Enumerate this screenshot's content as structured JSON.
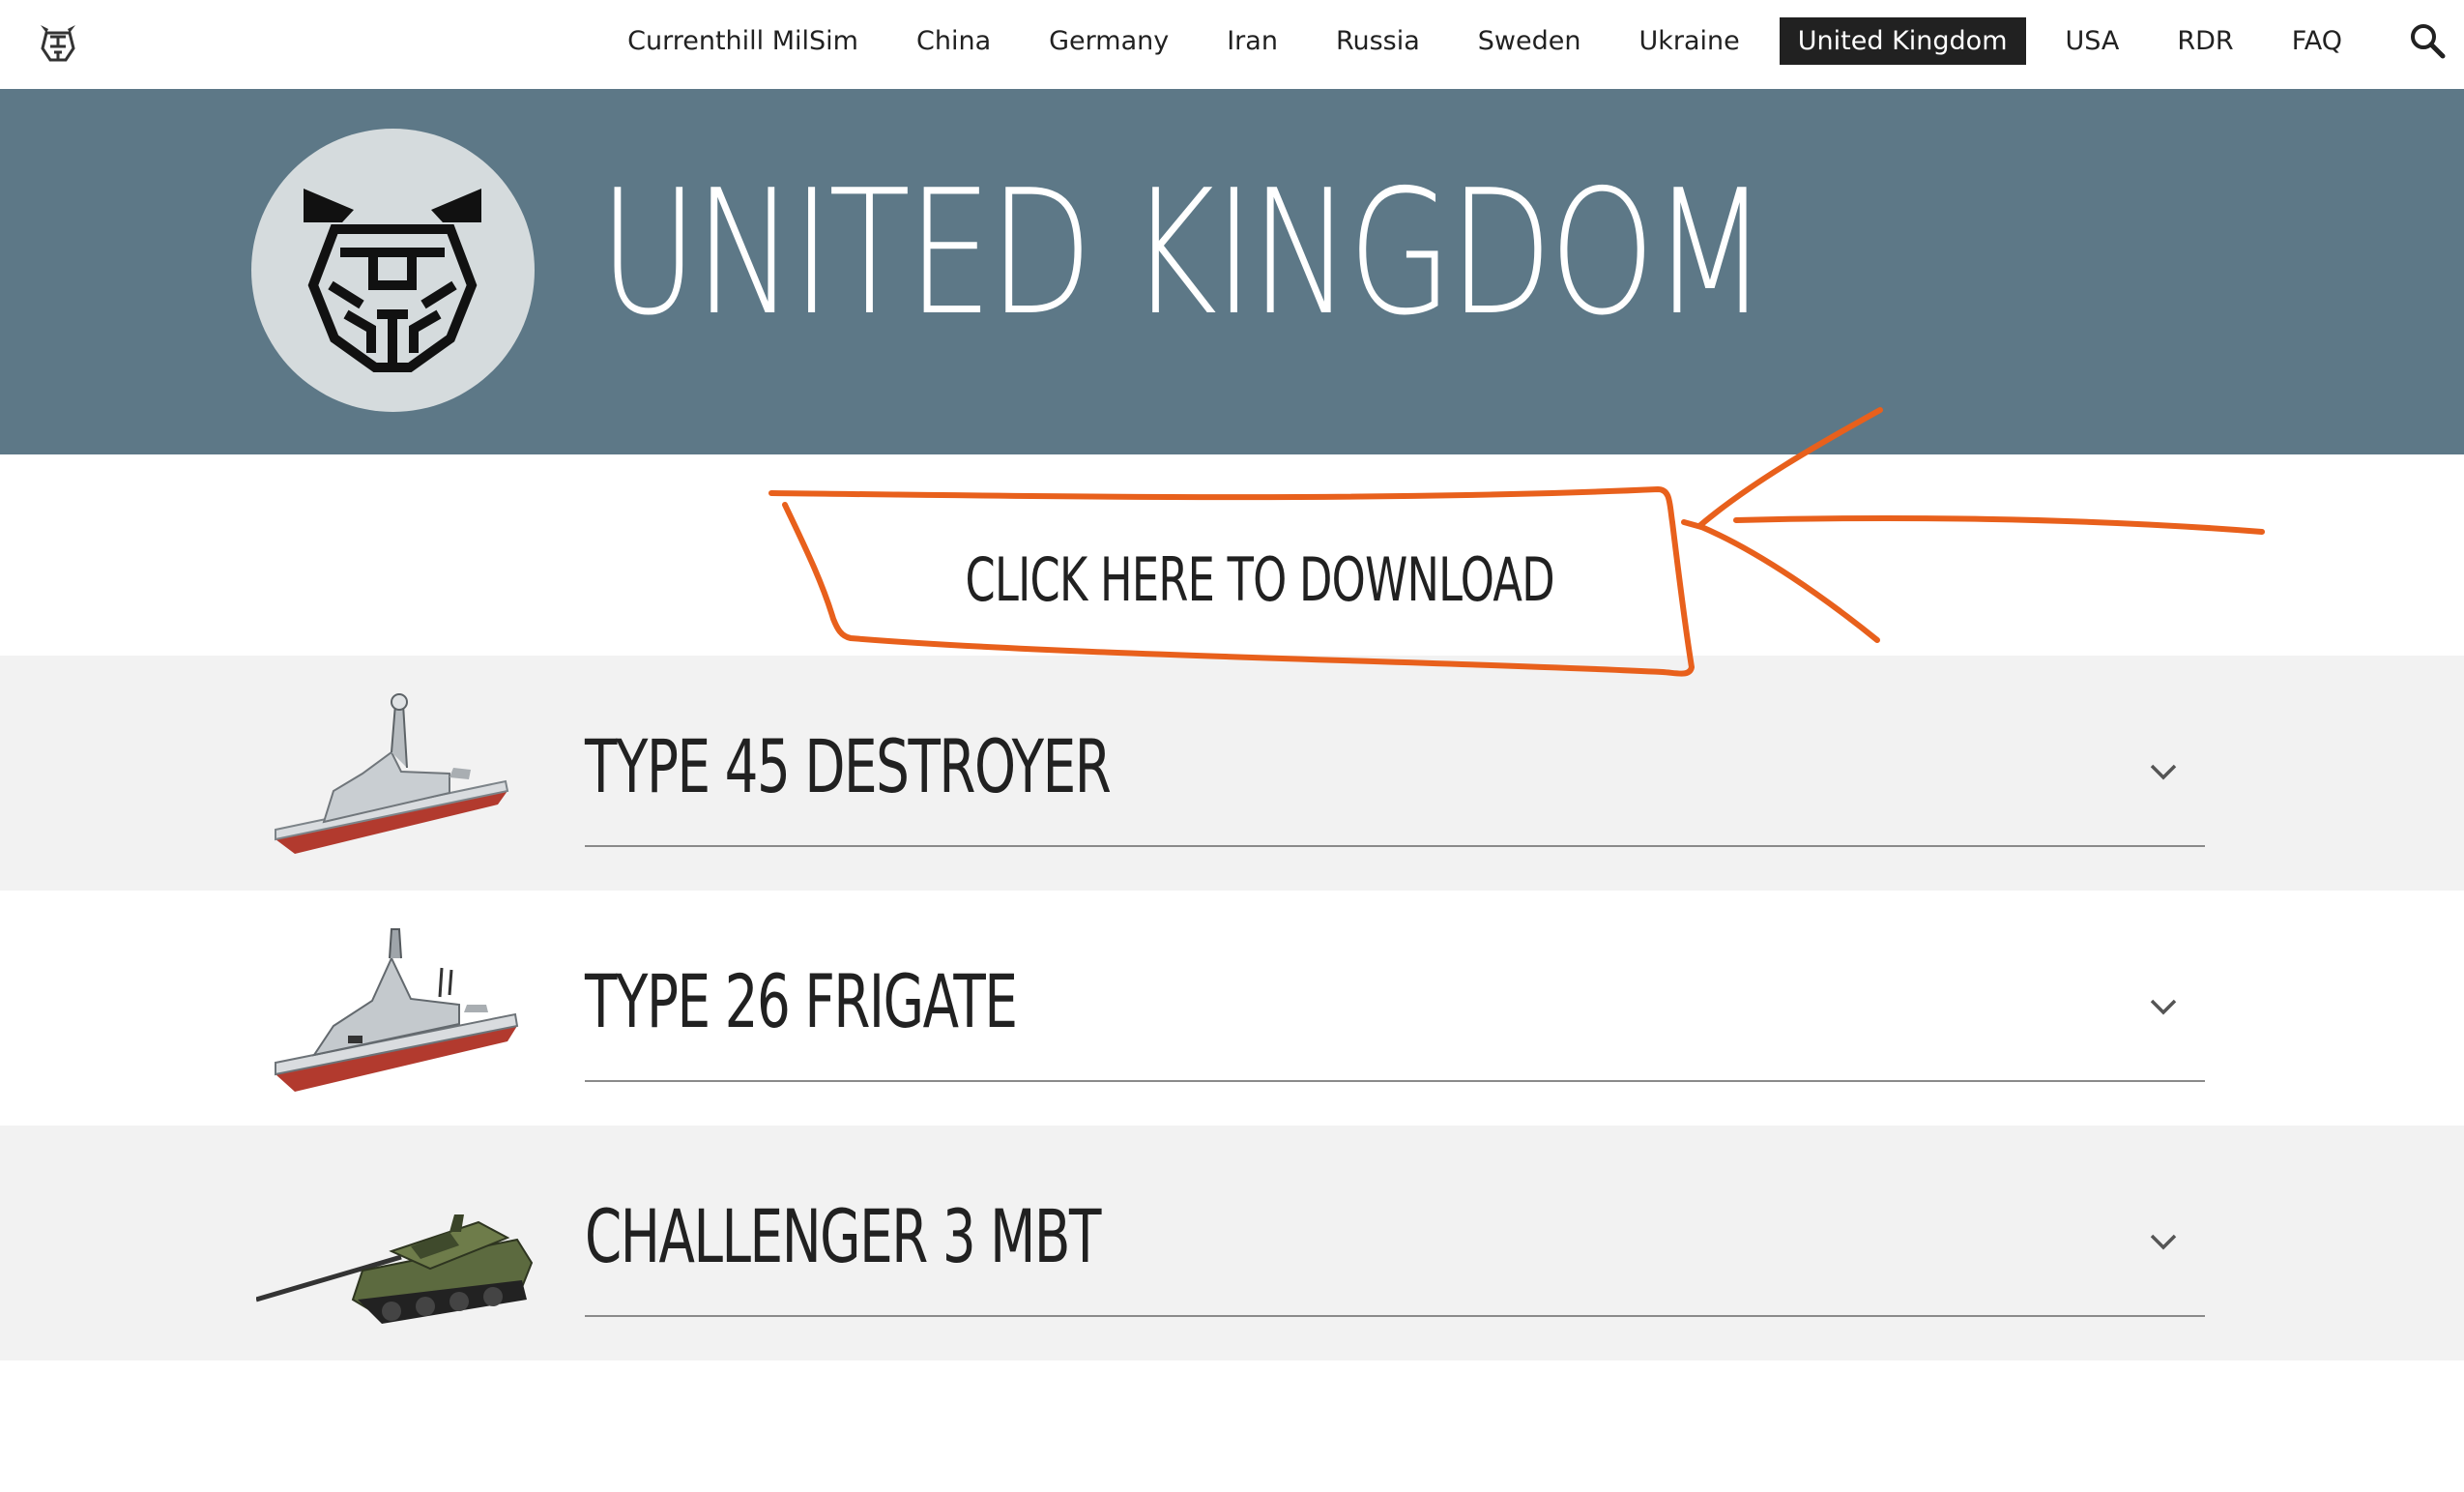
{
  "nav": {
    "items": [
      {
        "label": "Currenthill MilSim"
      },
      {
        "label": "China"
      },
      {
        "label": "Germany"
      },
      {
        "label": "Iran"
      },
      {
        "label": "Russia"
      },
      {
        "label": "Sweden"
      },
      {
        "label": "Ukraine"
      },
      {
        "label": "United Kingdom"
      },
      {
        "label": "USA"
      },
      {
        "label": "RDR"
      },
      {
        "label": "FAQ"
      }
    ],
    "active": "United Kingdom"
  },
  "hero": {
    "title": "UNITED KINGDOM"
  },
  "download": {
    "label": "CLICK HERE TO DOWNLOAD",
    "annotation_color": "#e8601c"
  },
  "sections": [
    {
      "label": "TYPE 45 DESTROYER",
      "image": "destroyer-ship-image"
    },
    {
      "label": "TYPE 26 FRIGATE",
      "image": "frigate-ship-image"
    },
    {
      "label": "CHALLENGER 3 MBT",
      "image": "tank-image"
    }
  ],
  "colors": {
    "hero_bg": "#5d7887",
    "emblem_bg": "#d5dbdd",
    "row_gray": "#f2f2f2",
    "text_dark": "#212121",
    "annotation_orange": "#e8601c"
  }
}
